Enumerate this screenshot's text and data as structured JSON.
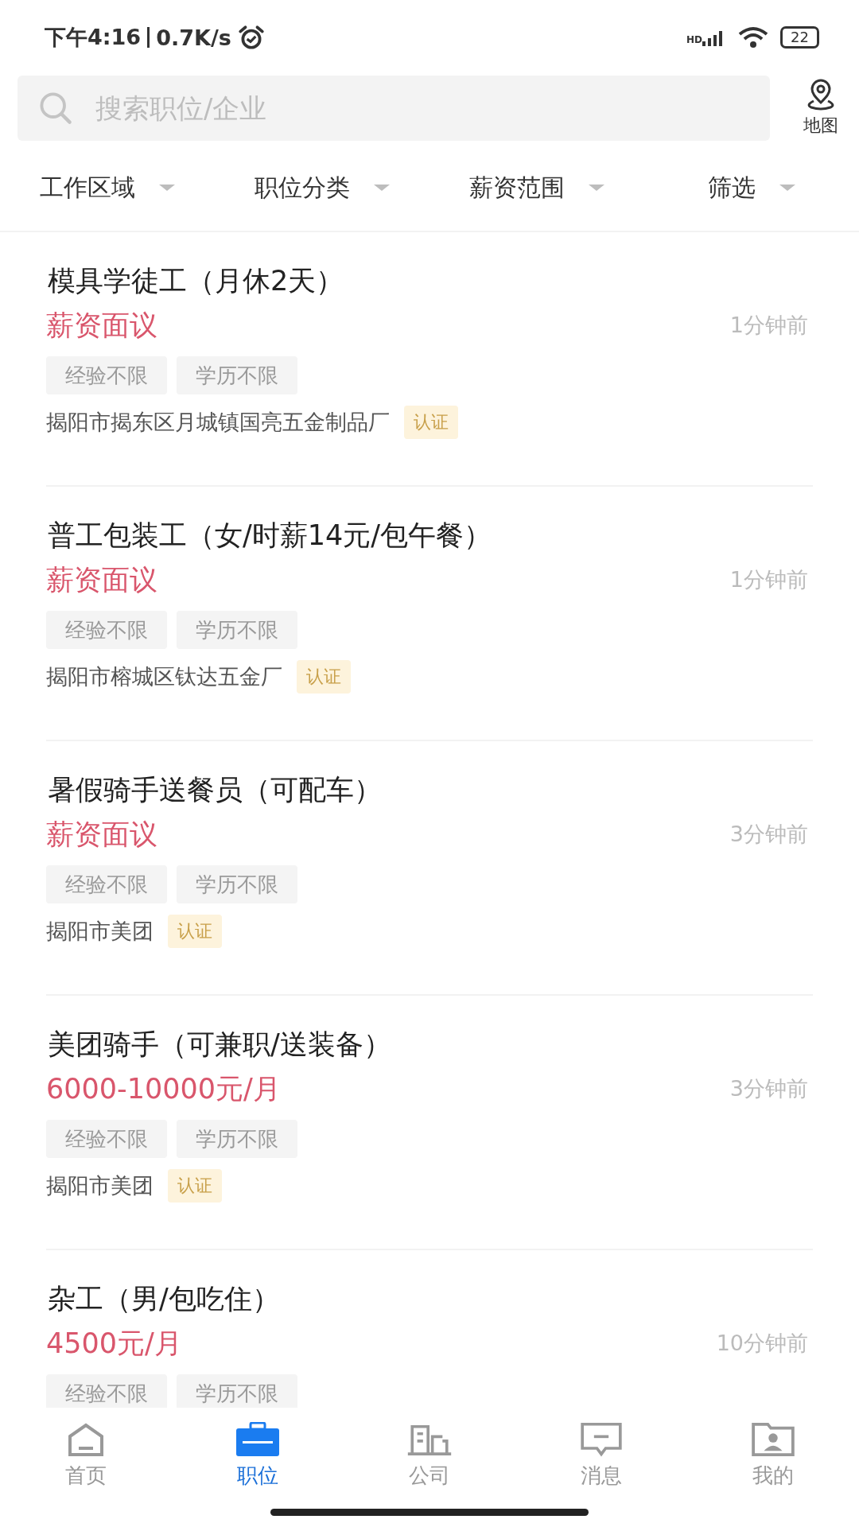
{
  "status_bar": {
    "time": "下午4:16",
    "speed": "0.7K/s",
    "network": "HD",
    "battery": "22"
  },
  "search": {
    "placeholder": "搜索职位/企业"
  },
  "map_button": {
    "label": "地图"
  },
  "filters": [
    {
      "label": "工作区域"
    },
    {
      "label": "职位分类"
    },
    {
      "label": "薪资范围"
    },
    {
      "label": "筛选"
    }
  ],
  "jobs": [
    {
      "title": "模具学徒工（月休2天）",
      "salary": "薪资面议",
      "time": "1分钟前",
      "tags": [
        "经验不限",
        "学历不限"
      ],
      "company": "揭阳市揭东区月城镇国亮五金制品厂",
      "badge": "认证"
    },
    {
      "title": "普工包装工（女/时薪14元/包午餐）",
      "salary": "薪资面议",
      "time": "1分钟前",
      "tags": [
        "经验不限",
        "学历不限"
      ],
      "company": "揭阳市榕城区钛达五金厂",
      "badge": "认证"
    },
    {
      "title": "暑假骑手送餐员（可配车）",
      "salary": "薪资面议",
      "time": "3分钟前",
      "tags": [
        "经验不限",
        "学历不限"
      ],
      "company": "揭阳市美团",
      "badge": "认证"
    },
    {
      "title": "美团骑手（可兼职/送装备）",
      "salary": "6000-10000元/月",
      "time": "3分钟前",
      "tags": [
        "经验不限",
        "学历不限"
      ],
      "company": "揭阳市美团",
      "badge": "认证"
    },
    {
      "title": "杂工（男/包吃住）",
      "salary": "4500元/月",
      "time": "10分钟前",
      "tags": [
        "经验不限",
        "学历不限"
      ]
    }
  ],
  "nav": [
    {
      "label": "首页",
      "kind": "home",
      "selected": false
    },
    {
      "label": "职位",
      "kind": "briefcase",
      "selected": true
    },
    {
      "label": "公司",
      "kind": "building",
      "selected": false
    },
    {
      "label": "消息",
      "kind": "message",
      "selected": false
    },
    {
      "label": "我的",
      "kind": "profile",
      "selected": false
    }
  ]
}
